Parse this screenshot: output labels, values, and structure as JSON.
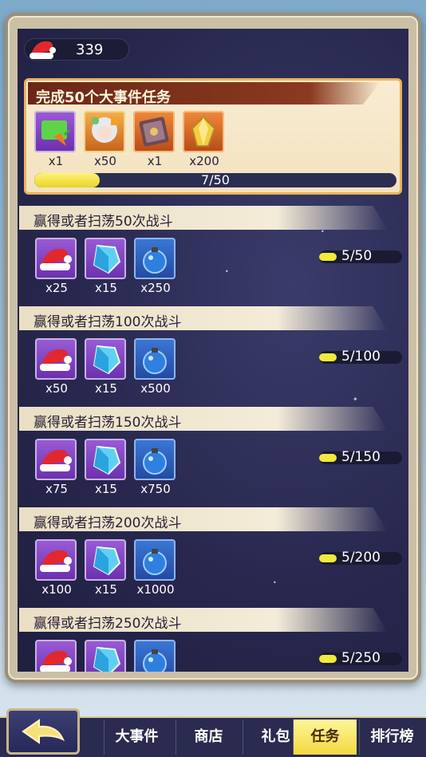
{
  "currency": {
    "icon": "santa-hat-icon",
    "amount": "339"
  },
  "main_task": {
    "title": "完成50个大事件任务",
    "rewards": [
      {
        "icon": "carrot-envelope-icon",
        "count": "x1",
        "frame": "purple"
      },
      {
        "icon": "character-portrait-icon",
        "count": "x50",
        "frame": "gold"
      },
      {
        "icon": "book-icon",
        "count": "x1",
        "frame": "orange"
      },
      {
        "icon": "gold-gem-icon",
        "count": "x200",
        "frame": "orange"
      }
    ],
    "progress": {
      "current": 7,
      "total": 50,
      "label": "7/50"
    }
  },
  "tasks": [
    {
      "title": "赢得或者扫荡50次战斗",
      "rewards": [
        {
          "icon": "santa-hat-icon",
          "count": "x25"
        },
        {
          "icon": "blue-crystal-icon",
          "count": "x15"
        },
        {
          "icon": "blue-bomb-icon",
          "count": "x250"
        }
      ],
      "progress": {
        "current": 5,
        "total": 50,
        "label": "5/50"
      }
    },
    {
      "title": "赢得或者扫荡100次战斗",
      "rewards": [
        {
          "icon": "santa-hat-icon",
          "count": "x50"
        },
        {
          "icon": "blue-crystal-icon",
          "count": "x15"
        },
        {
          "icon": "blue-bomb-icon",
          "count": "x500"
        }
      ],
      "progress": {
        "current": 5,
        "total": 100,
        "label": "5/100"
      }
    },
    {
      "title": "赢得或者扫荡150次战斗",
      "rewards": [
        {
          "icon": "santa-hat-icon",
          "count": "x75"
        },
        {
          "icon": "blue-crystal-icon",
          "count": "x15"
        },
        {
          "icon": "blue-bomb-icon",
          "count": "x750"
        }
      ],
      "progress": {
        "current": 5,
        "total": 150,
        "label": "5/150"
      }
    },
    {
      "title": "赢得或者扫荡200次战斗",
      "rewards": [
        {
          "icon": "santa-hat-icon",
          "count": "x100"
        },
        {
          "icon": "blue-crystal-icon",
          "count": "x15"
        },
        {
          "icon": "blue-bomb-icon",
          "count": "x1000"
        }
      ],
      "progress": {
        "current": 5,
        "total": 200,
        "label": "5/200"
      }
    },
    {
      "title": "赢得或者扫荡250次战斗",
      "rewards": [
        {
          "icon": "santa-hat-icon",
          "count": ""
        },
        {
          "icon": "blue-crystal-icon",
          "count": ""
        },
        {
          "icon": "blue-bomb-icon",
          "count": ""
        }
      ],
      "progress": {
        "current": 5,
        "total": 250,
        "label": "5/250"
      }
    }
  ],
  "nav": {
    "back_icon": "back-arrow-icon",
    "tabs": [
      "大事件",
      "商店",
      "礼包",
      "任务",
      "排行榜"
    ],
    "active_tab": "任务"
  },
  "colors": {
    "panel": "#28284f",
    "progress_fill": "#f1ea3a",
    "main_title_bar": "#7a311b",
    "active_tab": "#f6e15a"
  }
}
